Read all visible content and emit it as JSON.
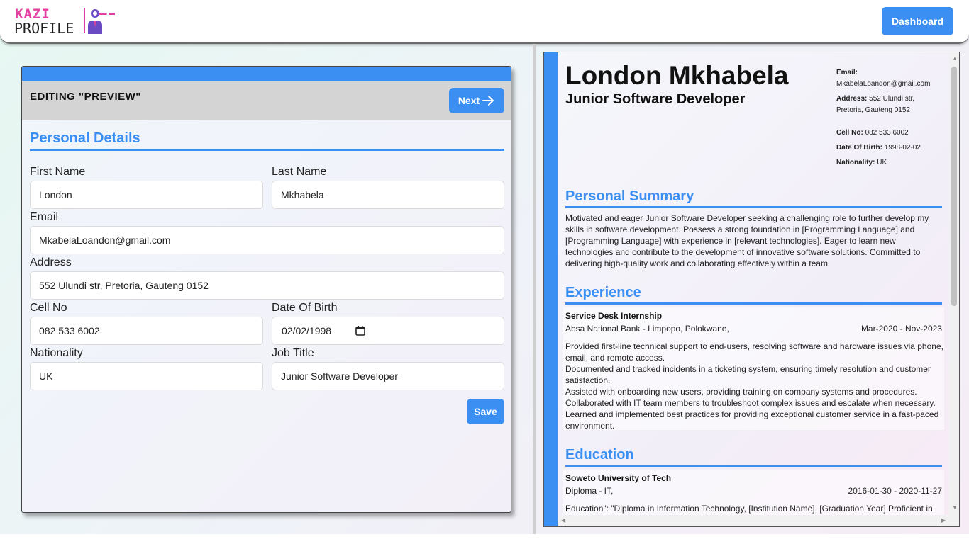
{
  "nav": {
    "logo_top": "KAZI",
    "logo_bottom": "PROFILE",
    "dashboard_label": "Dashboard"
  },
  "editor": {
    "title": "EDITING \"PREVIEW\"",
    "next_label": "Next",
    "section_title": "Personal Details",
    "fields": {
      "first_name": {
        "label": "First Name",
        "value": "London"
      },
      "last_name": {
        "label": "Last Name",
        "value": "Mkhabela"
      },
      "email": {
        "label": "Email",
        "value": "MkabelaLoandon@gmail.com"
      },
      "address": {
        "label": "Address",
        "value": "552 Ulundi str, Pretoria, Gauteng 0152"
      },
      "cell_no": {
        "label": "Cell No",
        "value": "082 533 6002"
      },
      "dob": {
        "label": "Date Of Birth",
        "value": "02/02/1998"
      },
      "nationality": {
        "label": "Nationality",
        "value": "UK"
      },
      "job_title": {
        "label": "Job Title",
        "value": "Junior Software Developer"
      }
    },
    "save_label": "Save"
  },
  "preview": {
    "name": "London Mkhabela",
    "job_title": "Junior Software Developer",
    "contact": {
      "email_label": "Email:",
      "email": "MkabelaLoandon@gmail.com",
      "address_label": "Address:",
      "address_line1": "552 Ulundi str,",
      "address_line2": "Pretoria, Gauteng 0152",
      "cell_label": "Cell No:",
      "cell": "082 533 6002",
      "dob_label": "Date Of Birth:",
      "dob": "1998-02-02",
      "nationality_label": "Nationality:",
      "nationality": "UK"
    },
    "summary_title": "Personal Summary",
    "summary": "Motivated and eager Junior Software Developer seeking a challenging role to further develop my skills in software development. Possess a strong foundation in [Programming Language] and [Programming Language] with experience in [relevant technologies]. Eager to learn new technologies and contribute to the development of innovative software solutions. Committed to delivering high-quality work and collaborating effectively within a team",
    "experience_title": "Experience",
    "experience": {
      "role": "Service Desk Internship",
      "company": "Absa National Bank - Limpopo, Polokwane,",
      "dates": "Mar-2020 - Nov-2023",
      "bullets": [
        "Provided first-line technical support to end-users, resolving software and hardware issues via phone, email, and remote access.",
        "Documented and tracked incidents in a ticketing system, ensuring timely resolution and customer satisfaction.",
        "Assisted with onboarding new users, providing training on company systems and procedures.",
        "Collaborated with IT team members to troubleshoot complex issues and escalate when necessary.",
        "Learned and implemented best practices for providing exceptional customer service in a fast-paced environment."
      ]
    },
    "education_title": "Education",
    "education": {
      "school": "Soweto University of Tech",
      "qualification": "Diploma - IT,",
      "dates": "2016-01-30 - 2020-11-27",
      "description": "Education\": \"Diploma in Information Technology, [Institution Name], [Graduation Year] Proficient in"
    }
  }
}
